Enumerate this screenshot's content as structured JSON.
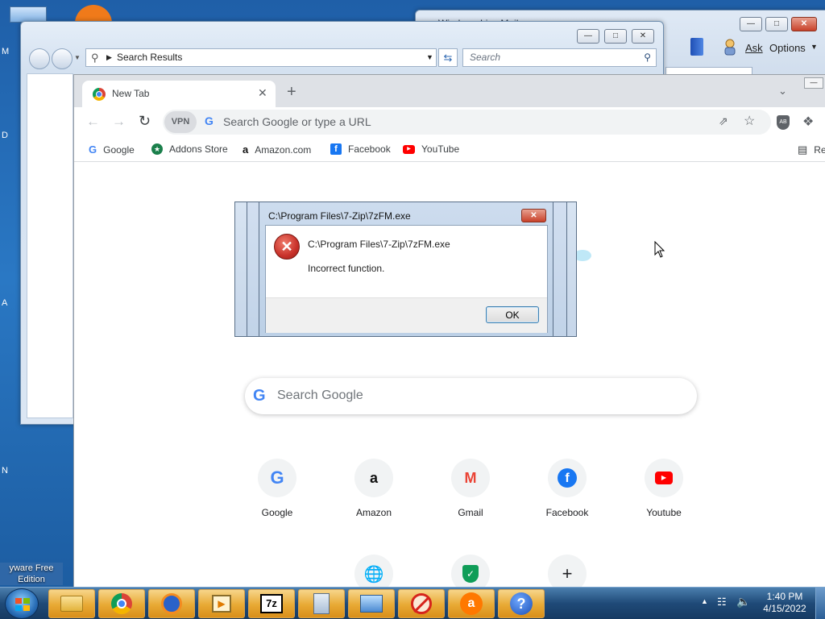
{
  "desktop": {
    "letters": [
      "M",
      "D",
      "A",
      "N"
    ],
    "caption_line1": "yware Free",
    "caption_line2": "Edition"
  },
  "right_window": {
    "title": "Windows Live Mail",
    "ask_label": "Ask",
    "options_label": "Options"
  },
  "explorer": {
    "address_text": "Search Results",
    "search_placeholder": "Search"
  },
  "chrome": {
    "tab_title": "New Tab",
    "omnibox_placeholder": "Search Google or type a URL",
    "vpn_label": "VPN",
    "bookmarks": [
      {
        "label": "Google",
        "icon": "google-icon"
      },
      {
        "label": "Addons Store",
        "icon": "addons-store-icon"
      },
      {
        "label": "Amazon.com",
        "icon": "amazon-icon"
      },
      {
        "label": "Facebook",
        "icon": "facebook-icon"
      },
      {
        "label": "YouTube",
        "icon": "youtube-icon"
      }
    ],
    "reading_list_label": "Re",
    "search_box_placeholder": "Search Google",
    "shortcuts": [
      {
        "label": "Google"
      },
      {
        "label": "Amazon"
      },
      {
        "label": "Gmail"
      },
      {
        "label": "Facebook"
      },
      {
        "label": "Youtube"
      }
    ]
  },
  "dialog": {
    "title": "C:\\Program Files\\7-Zip\\7zFM.exe",
    "path": "C:\\Program Files\\7-Zip\\7zFM.exe",
    "message": "Incorrect function.",
    "ok_label": "OK"
  },
  "taskbar": {
    "time": "1:40 PM",
    "date": "4/15/2022",
    "apps": [
      "explorer",
      "chrome",
      "avast-secure-browser",
      "media",
      "7-zip",
      "calculator",
      "control-panel",
      "blocked-app",
      "avast",
      "help"
    ]
  },
  "colors": {
    "desktop_blue": "#2a78c4",
    "error_red": "#c8312a",
    "taskbar_blue": "#1f4a78",
    "chrome_frame": "#dee1e6"
  }
}
